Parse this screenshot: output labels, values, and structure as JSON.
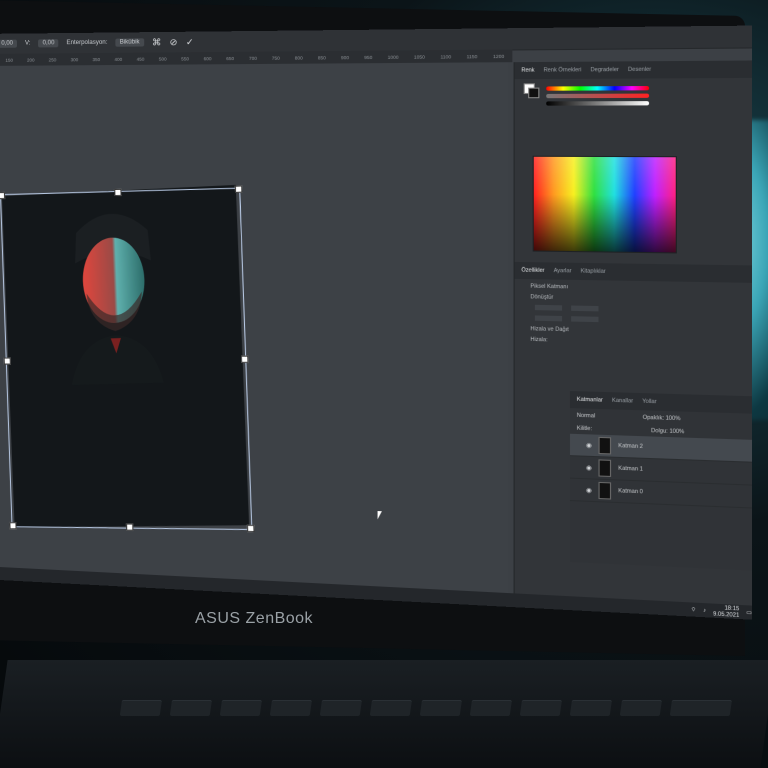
{
  "options_bar": {
    "y_label": "Y:",
    "y_value": "0,00",
    "v_label": "V:",
    "v_value": "0,00",
    "interp_label": "Enterpolasyon:",
    "interp_value": "Bikübik"
  },
  "ruler_ticks": [
    "100",
    "150",
    "200",
    "250",
    "300",
    "350",
    "400",
    "450",
    "500",
    "550",
    "600",
    "650",
    "700",
    "750",
    "800",
    "850",
    "900",
    "950",
    "1000",
    "1050",
    "1100",
    "1150",
    "1200",
    "1250",
    "1300",
    "1350",
    "1400",
    "1450",
    "1500",
    "1550",
    "1600",
    "1650",
    "1700",
    "1750"
  ],
  "right_panel": {
    "color_tabs": [
      "Renk",
      "Renk Örnekleri",
      "Degradeler",
      "Desenler"
    ],
    "props_tabs": [
      "Özellikler",
      "Ayarlar",
      "Kitaplıklar"
    ],
    "pixel_layer": "Piksel Katmanı",
    "transform_title": "Dönüştür",
    "align_title": "Hizala ve Dağıt",
    "align_label": "Hizala:"
  },
  "layers_panel": {
    "tabs": [
      "Katmanlar",
      "Kanallar",
      "Yollar"
    ],
    "blend_mode": "Normal",
    "opacity_label": "Opaklık:",
    "opacity_value": "100%",
    "lock_label": "Kilitle:",
    "fill_label": "Dolgu:",
    "fill_value": "100%",
    "items": [
      {
        "name": "Katman 2",
        "selected": true
      },
      {
        "name": "Katman 1",
        "selected": false
      },
      {
        "name": "Katman 0",
        "selected": false
      }
    ]
  },
  "taskbar": {
    "time": "18:15",
    "date": "9.05.2021"
  },
  "brand": "ASUS ZenBook"
}
